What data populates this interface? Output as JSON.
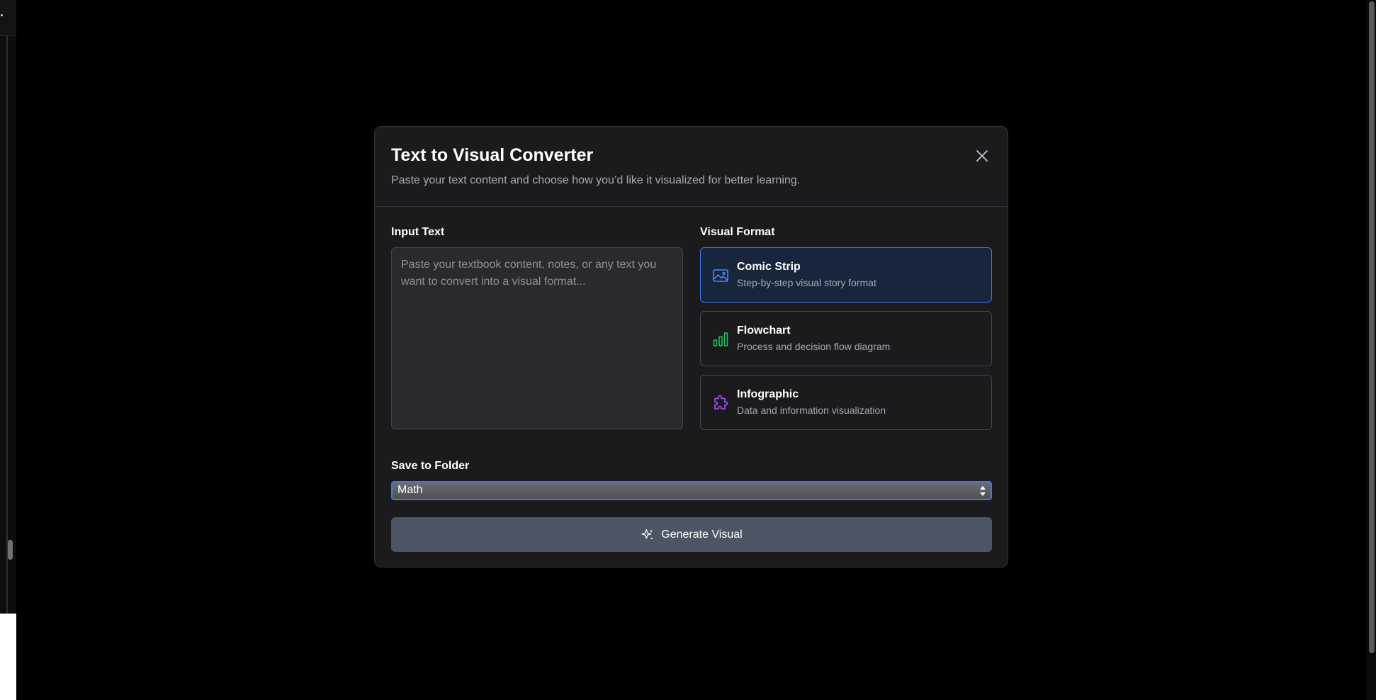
{
  "modal": {
    "title": "Text to Visual Converter",
    "subtitle": "Paste your text content and choose how you’d like it visualized for better learning.",
    "close_icon": "close-icon"
  },
  "input": {
    "label": "Input Text",
    "value": "",
    "placeholder": "Paste your textbook content, notes, or any text you want to convert into a visual format..."
  },
  "formats": {
    "label": "Visual Format",
    "selected": "Comic Strip",
    "items": [
      {
        "name": "Comic Strip",
        "description": "Step-by-step visual story format",
        "icon": "image-icon",
        "color": "#4a8af0"
      },
      {
        "name": "Flowchart",
        "description": "Process and decision flow diagram",
        "icon": "bar-chart-icon",
        "color": "#22c55e"
      },
      {
        "name": "Infographic",
        "description": "Data and information visualization",
        "icon": "puzzle-icon",
        "color": "#a855f7"
      }
    ]
  },
  "folder": {
    "label": "Save to Folder",
    "selected": "Math"
  },
  "generate": {
    "label": "Generate Visual",
    "icon": "sparkle-icon"
  },
  "colors": {
    "accent": "#3b7ae6",
    "background": "#000000",
    "modal_bg": "#1b1b1e",
    "button_bg": "#4b5563"
  }
}
